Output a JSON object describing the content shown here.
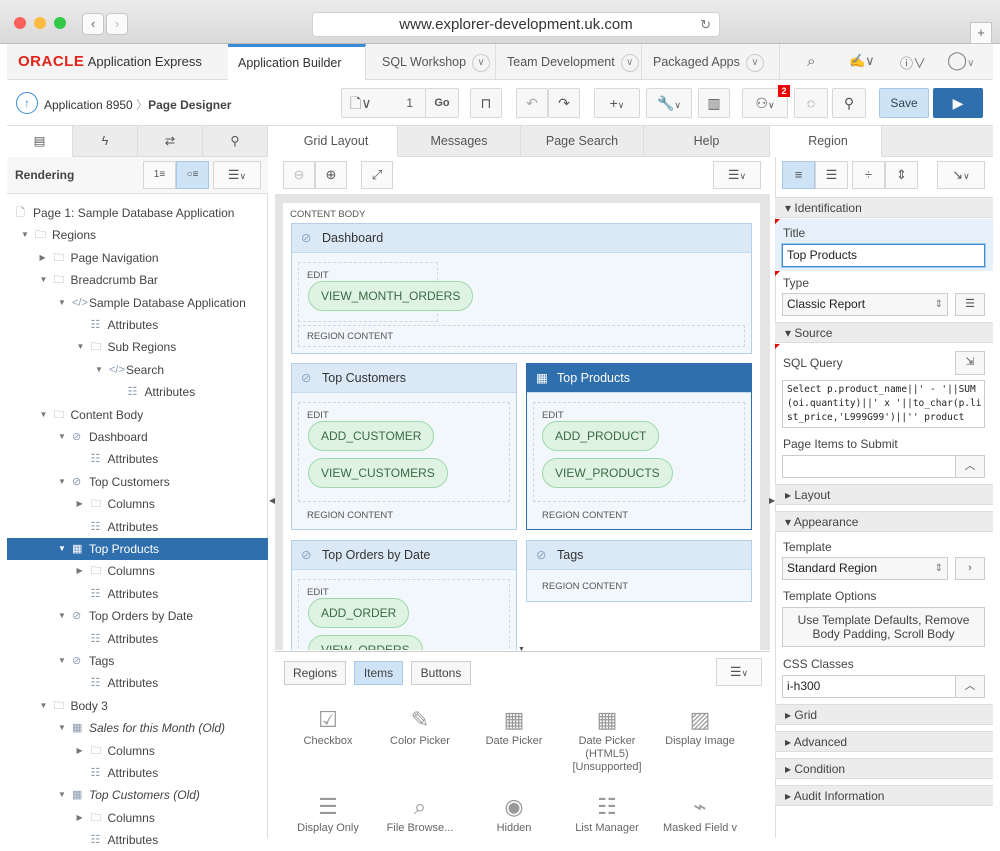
{
  "browser": {
    "url": "www.explorer-development.uk.com",
    "back": "‹",
    "forward": "›",
    "new_tab": "+"
  },
  "nav": {
    "logo_brand": "ORACLE",
    "logo_product": "Application Express",
    "tabs": [
      "Application Builder",
      "SQL Workshop",
      "Team Development",
      "Packaged Apps"
    ],
    "active_tab": 0
  },
  "toolbar": {
    "breadcrumb": [
      "Application 8950",
      "Page Designer"
    ],
    "page_number": "1",
    "go_label": "Go",
    "notification_count": "2",
    "save_label": "Save"
  },
  "left": {
    "title": "Rendering",
    "tree": [
      {
        "l": 0,
        "t": "Page 1: Sample Database Application",
        "ic": "page"
      },
      {
        "l": 1,
        "t": "Regions",
        "ic": "folder",
        "a": "open"
      },
      {
        "l": 2,
        "t": "Page Navigation",
        "ic": "folder",
        "a": "closed"
      },
      {
        "l": 2,
        "t": "Breadcrumb Bar",
        "ic": "folder",
        "a": "open"
      },
      {
        "l": 3,
        "t": "Sample Database Application",
        "ic": "code",
        "a": "open"
      },
      {
        "l": 4,
        "t": "Attributes",
        "ic": "list"
      },
      {
        "l": 4,
        "t": "Sub Regions",
        "ic": "folder",
        "a": "open"
      },
      {
        "l": 5,
        "t": "Search",
        "ic": "code",
        "a": "open"
      },
      {
        "l": 6,
        "t": "Attributes",
        "ic": "list"
      },
      {
        "l": 2,
        "t": "Content Body",
        "ic": "folder",
        "a": "open"
      },
      {
        "l": 3,
        "t": "Dashboard",
        "ic": "region",
        "a": "open"
      },
      {
        "l": 4,
        "t": "Attributes",
        "ic": "list"
      },
      {
        "l": 3,
        "t": "Top Customers",
        "ic": "region",
        "a": "open"
      },
      {
        "l": 4,
        "t": "Columns",
        "ic": "folder",
        "a": "closed"
      },
      {
        "l": 4,
        "t": "Attributes",
        "ic": "list"
      },
      {
        "l": 3,
        "t": "Top Products",
        "ic": "table",
        "a": "open",
        "sel": true
      },
      {
        "l": 4,
        "t": "Columns",
        "ic": "folder",
        "a": "closed"
      },
      {
        "l": 4,
        "t": "Attributes",
        "ic": "list"
      },
      {
        "l": 3,
        "t": "Top Orders by Date",
        "ic": "region",
        "a": "open"
      },
      {
        "l": 4,
        "t": "Attributes",
        "ic": "list"
      },
      {
        "l": 3,
        "t": "Tags",
        "ic": "region",
        "a": "open"
      },
      {
        "l": 4,
        "t": "Attributes",
        "ic": "list"
      },
      {
        "l": 2,
        "t": "Body 3",
        "ic": "folder",
        "a": "open"
      },
      {
        "l": 3,
        "t": "Sales for this Month (Old)",
        "ic": "table",
        "a": "open",
        "it": true
      },
      {
        "l": 4,
        "t": "Columns",
        "ic": "folder",
        "a": "closed"
      },
      {
        "l": 4,
        "t": "Attributes",
        "ic": "list"
      },
      {
        "l": 3,
        "t": "Top Customers (Old)",
        "ic": "table",
        "a": "open",
        "it": true
      },
      {
        "l": 4,
        "t": "Columns",
        "ic": "folder",
        "a": "closed"
      },
      {
        "l": 4,
        "t": "Attributes",
        "ic": "list"
      }
    ]
  },
  "center": {
    "tabs": [
      "Grid Layout",
      "Messages",
      "Page Search",
      "Help"
    ],
    "content_body": "CONTENT BODY",
    "edit": "EDIT",
    "region_content": "REGION CONTENT",
    "regions": {
      "dashboard": "Dashboard",
      "top_customers": "Top Customers",
      "top_products": "Top Products",
      "top_orders": "Top Orders by Date",
      "tags": "Tags"
    },
    "buttons": {
      "view_month_orders": "VIEW_MONTH_ORDERS",
      "add_customer": "ADD_CUSTOMER",
      "view_customers": "VIEW_CUSTOMERS",
      "add_product": "ADD_PRODUCT",
      "view_products": "VIEW_PRODUCTS",
      "add_order": "ADD_ORDER",
      "view_orders": "VIEW_ORDERS"
    },
    "gallery_tabs": [
      "Regions",
      "Items",
      "Buttons"
    ],
    "gallery_active": 1,
    "items": [
      {
        "t": "Checkbox",
        "i": "☑"
      },
      {
        "t": "Color Picker",
        "i": "✎"
      },
      {
        "t": "Date Picker",
        "i": "▦"
      },
      {
        "t": "Date Picker (HTML5) [Unsupported]",
        "i": "▦"
      },
      {
        "t": "Display Image",
        "i": "▨"
      },
      {
        "t": "Display Only",
        "i": "☰"
      },
      {
        "t": "File Browse...",
        "i": "⌕"
      },
      {
        "t": "Hidden",
        "i": "◉"
      },
      {
        "t": "List Manager",
        "i": "☷"
      },
      {
        "t": "Masked Field v",
        "i": "⌁"
      }
    ]
  },
  "right": {
    "tab": "Region",
    "identification": "Identification",
    "title_label": "Title",
    "title_value": "Top Products",
    "type_label": "Type",
    "type_value": "Classic Report",
    "source": "Source",
    "sql_label": "SQL Query",
    "sql_value": "Select p.product_name||' - '||SUM(oi.quantity)||' x '||to_char(p.list_price,'L999G99')||'' product",
    "items_submit_label": "Page Items to Submit",
    "items_submit_value": "",
    "layout": "Layout",
    "appearance": "Appearance",
    "template_label": "Template",
    "template_value": "Standard Region",
    "template_options_label": "Template Options",
    "template_options_value": "Use Template Defaults, Remove Body Padding, Scroll Body",
    "css_label": "CSS Classes",
    "css_value": "i-h300",
    "grid": "Grid",
    "advanced": "Advanced",
    "condition": "Condition",
    "audit": "Audit Information"
  },
  "colors": {
    "accent": "#2f6fad",
    "save": "#cfe3f6",
    "run": "#2f6fad",
    "oracle_red": "#e2231a",
    "badge": "#e00000"
  }
}
